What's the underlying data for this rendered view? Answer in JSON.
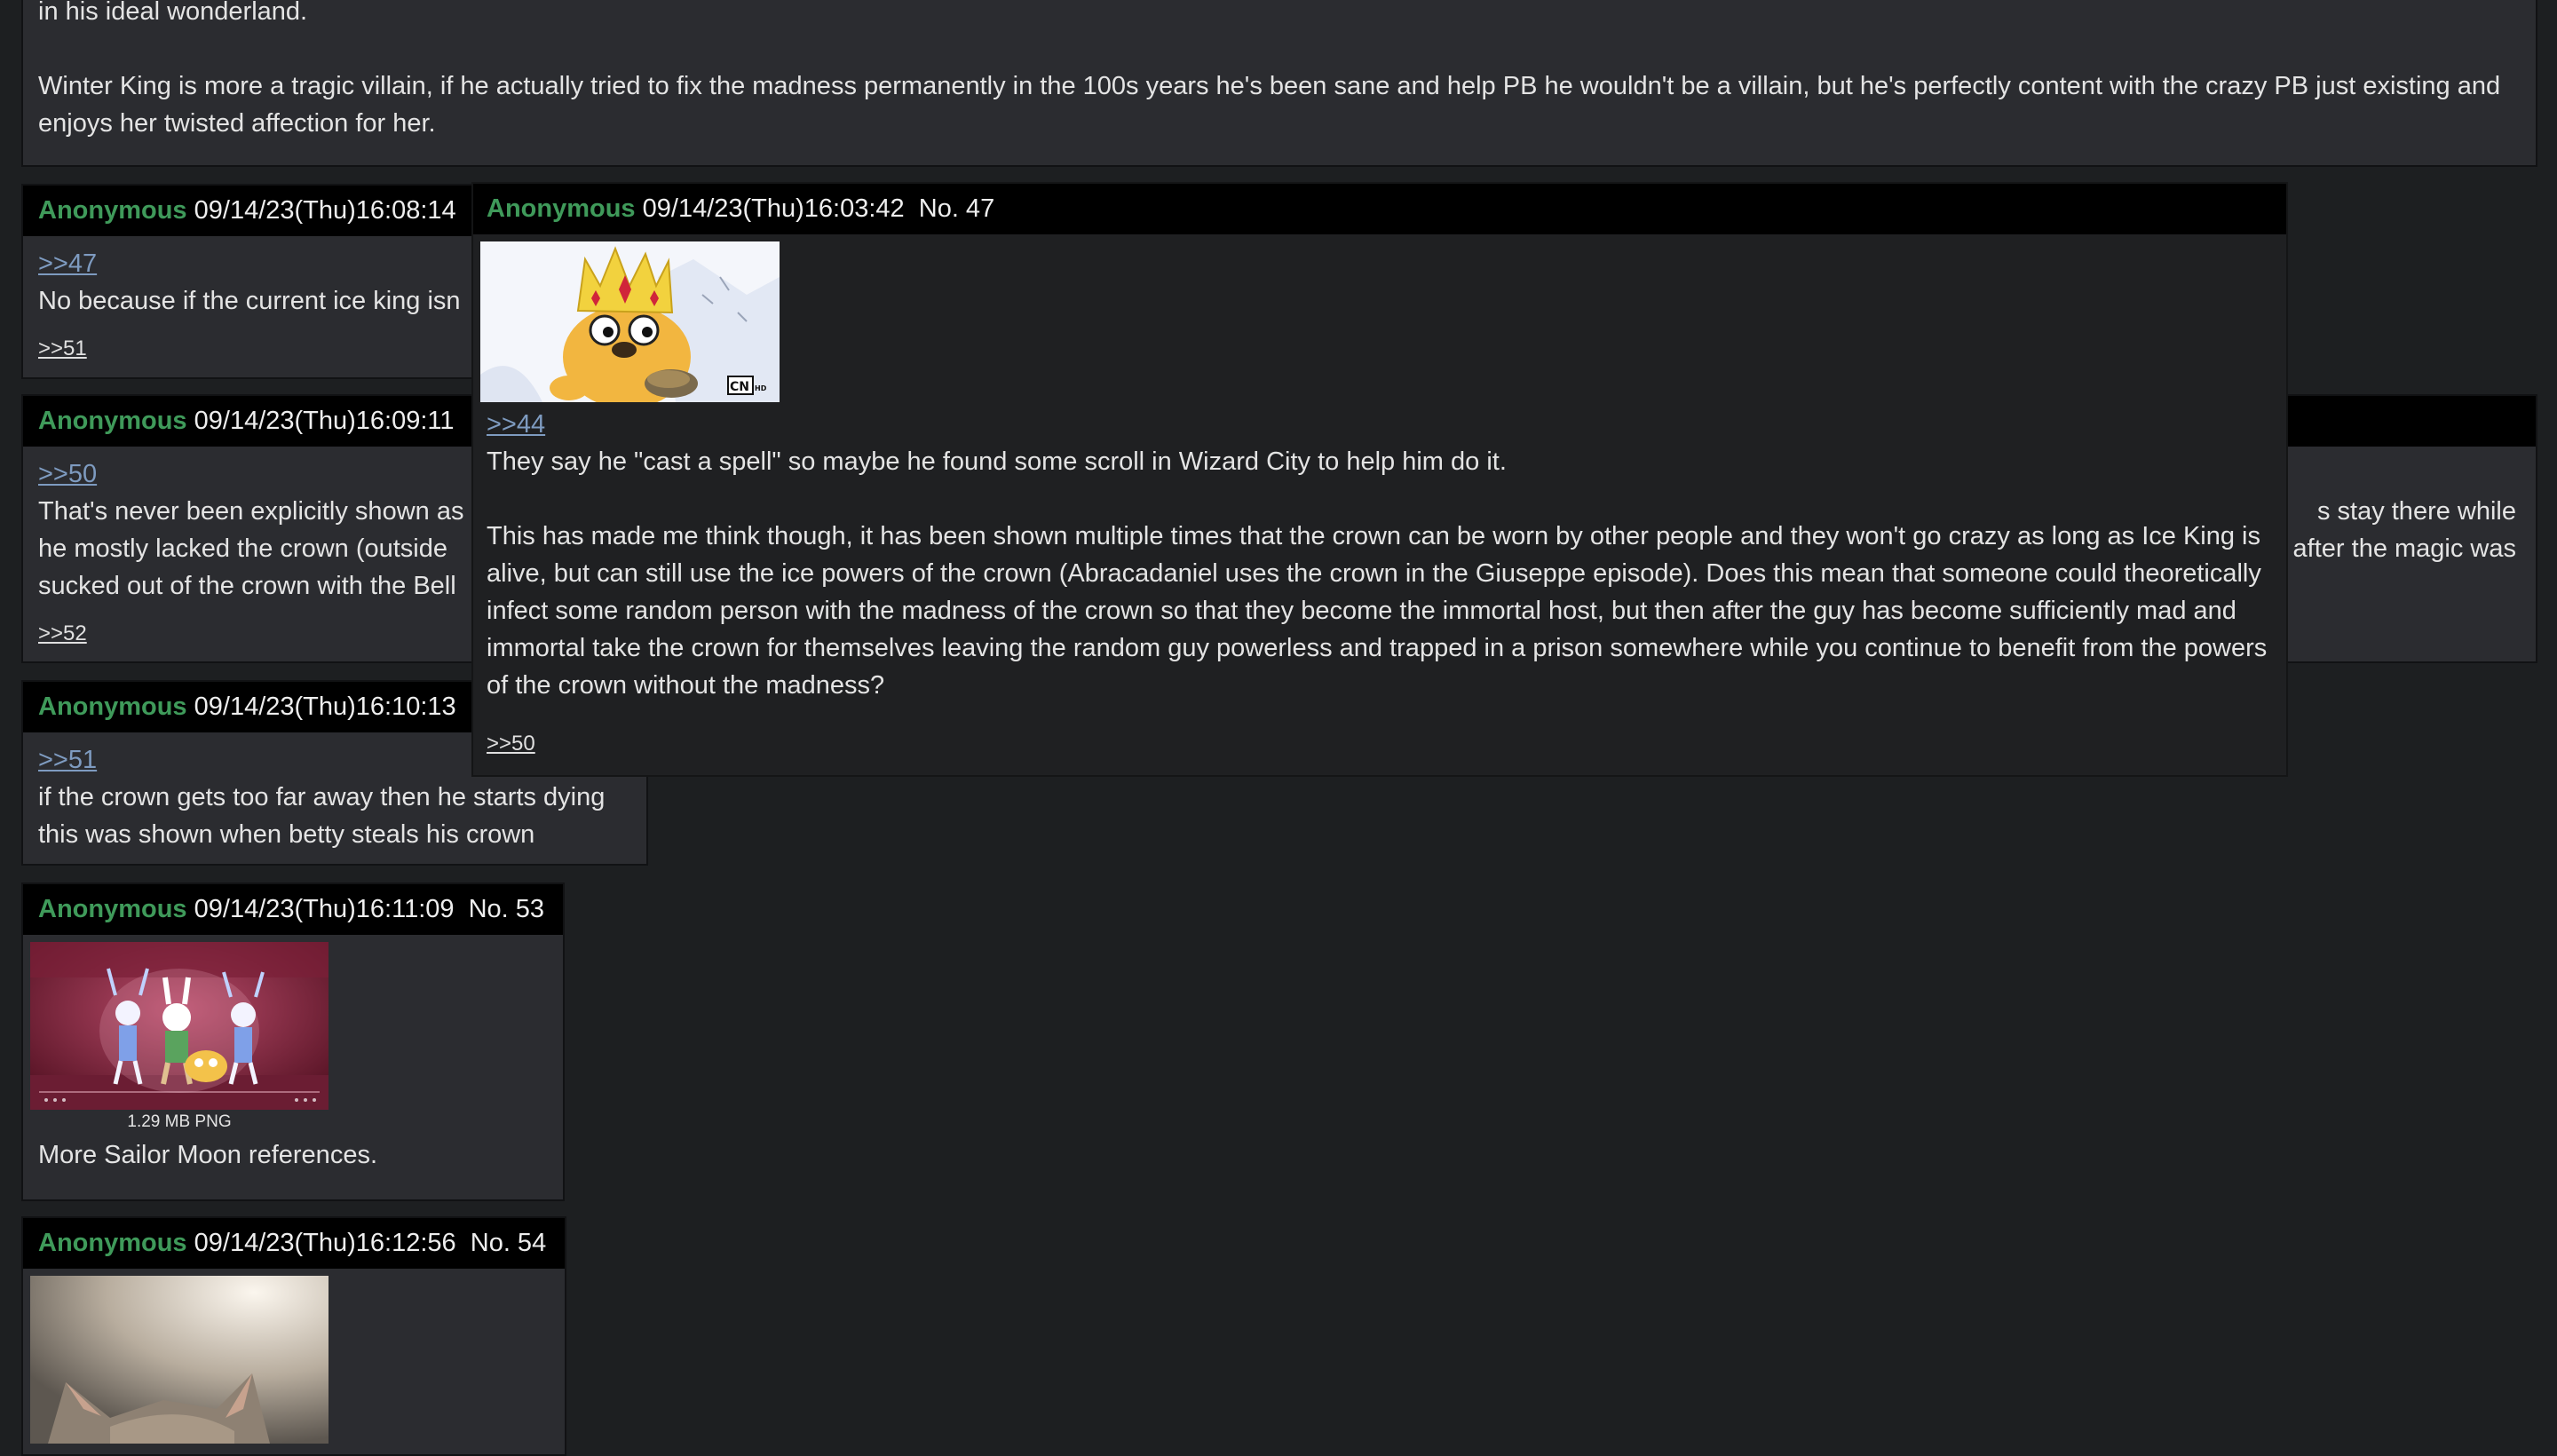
{
  "top_post": {
    "partial_line": "in his ideal wonderland.",
    "paragraph": "Winter King is more a tragic villain, if he actually tried to fix the madness permanently in the 100s years he's been sane and help PB he wouldn't be a villain, but he's perfectly content with the crazy PB just existing and enjoys her twisted affection for her."
  },
  "posts": [
    {
      "name": "Anonymous",
      "datetime": "09/14/23(Thu)16:08:14",
      "quote": ">>47",
      "comment": "No because if the current ice king isn",
      "reply": ">>51"
    },
    {
      "name": "Anonymous",
      "datetime": "09/14/23(Thu)16:09:11",
      "quote": ">>50",
      "comment_lines": [
        "That's never been explicitly shown as",
        "he mostly lacked the crown (outside",
        "sucked out of the crown with the Bell"
      ],
      "right_fragments": [
        "s stay there while",
        "after the magic was"
      ],
      "reply": ">>52"
    },
    {
      "name": "Anonymous",
      "datetime": "09/14/23(Thu)16:10:13",
      "quote": ">>51",
      "comment_lines": [
        "if the crown gets too far away then he starts dying",
        "this was shown when betty steals his crown"
      ]
    },
    {
      "name": "Anonymous",
      "datetime": "09/14/23(Thu)16:11:09",
      "number": "No. 53",
      "file_info": "1.29 MB PNG",
      "comment": "More Sailor Moon references."
    },
    {
      "name": "Anonymous",
      "datetime": "09/14/23(Thu)16:12:56",
      "number": "No. 54"
    }
  ],
  "popup": {
    "name": "Anonymous",
    "datetime": "09/14/23(Thu)16:03:42",
    "number": "No. 47",
    "quote": ">>44",
    "paragraph1": "They say he \"cast a spell\" so maybe he found some scroll in Wizard City to help him do it.",
    "paragraph2": "This has made me think though, it has been shown multiple times that the crown can be worn by other people and they won't go crazy as long as Ice King is alive, but can still use the ice powers of the crown (Abracadaniel uses the crown in the Giuseppe episode). Does this mean that someone could theoretically infect some random person with the madness of the crown so that they become the immortal host, but then after the guy has become sufficiently mad and immortal take the crown for themselves leaving the random guy powerless and trapped in a prison somewhere while you continue to benefit from the powers of the crown without the madness?",
    "reply": ">>50",
    "watermark": "CN HD"
  },
  "colors": {
    "background": "#1d1f21",
    "post_bg": "#2b2c30",
    "header_bg": "#000000",
    "name": "#3f9a5a",
    "quote_link": "#7e9bc0",
    "popup_bg": "#1f2022"
  }
}
